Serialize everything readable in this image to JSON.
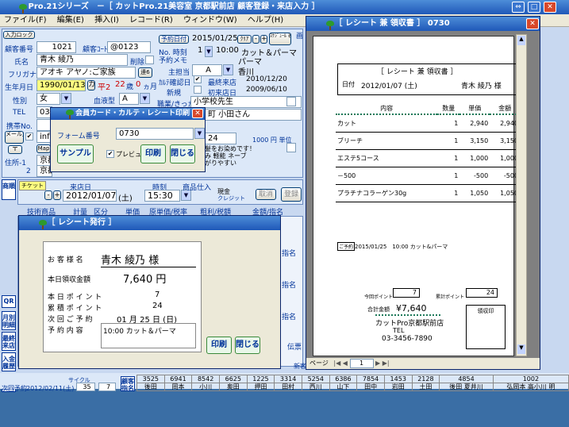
{
  "app": {
    "title": "Pro.21シリーズ　－［ カットPro.21美容室 京都駅前店 顧客登録・来店入力 ］"
  },
  "menu": [
    "ファイル(F)",
    "編集(E)",
    "挿入(I)",
    "レコード(R)",
    "ウィンドウ(W)",
    "ヘルプ(H)"
  ],
  "customer": {
    "entry_label": "入力ロック",
    "no_label": "顧客番号",
    "no": "1021",
    "code_label": "顧客ｺｰﾄﾞ",
    "code": "@0123",
    "name_label": "氏名",
    "name": "青木 綾乃",
    "delete_label": "削除",
    "kana_label": "フリガナ",
    "kana": "アオキ アヤノ:ご家族",
    "family_btn": "連6",
    "birth_label": "生年月日",
    "birth": "1990/01/13",
    "era": "平2",
    "age": "22",
    "age_unit": "歳",
    "months": "0",
    "months_unit": "ヵ月",
    "sex_label": "性別",
    "sex": "女",
    "blood_label": "血液型",
    "blood": "A",
    "tel_label": "TEL",
    "tel": "03-",
    "mobile_label": "携帯No.",
    "mail": "info",
    "addr_btn": "〒",
    "addr_label": "住所-1",
    "addr2_num": "2",
    "addr1": "京都",
    "addr2": "京都",
    "btn_mail": "メール送信",
    "btn_map": "Map"
  },
  "reserve": {
    "date_label": "予約日付",
    "date": "2015/01/25",
    "clear": "ｸﾘｱ",
    "btn_minus": "-",
    "btn_plus": "+",
    "sched_btn": "ｽｹｼﾞｭｰﾙ 表示",
    "no_label": "No. 時刻",
    "no": "1",
    "time": "10:00",
    "menu": "カット＆パーマ",
    "memo_label": "予約メモ",
    "staff_label": "主担当",
    "staff_code": "A",
    "staff_name": "香川",
    "dm_label": "ｶﾙﾃ確認日",
    "last_visit_label": "最終来店",
    "last_visit": "2010/12/20",
    "new_label": "新規",
    "first_visit_label": "初来店日",
    "first_visit": "2009/06/10",
    "job_label": "職業/きっかけ",
    "job": "小学校先生",
    "intro": "町 小田さん",
    "points": "24",
    "unit": "1000 円 単位",
    "note1": "髪をお染めです！",
    "note2": "み 軽能 ネーブ",
    "note3": "がりやすい"
  },
  "visit": {
    "tickets": "チケット",
    "date_label": "来店日",
    "date": "2012/01/07",
    "dow": "(土)",
    "time_label": "時刻",
    "time": "15:30",
    "goods_label": "商品仕入",
    "cash": "現金",
    "credit": "クレジット",
    "cancel": "取消",
    "register": "登録"
  },
  "table_head": [
    "技術商品",
    "計量",
    "区分",
    "単価",
    "原単価/税率",
    "粗利/税額",
    "金額/指名",
    "担当・年"
  ],
  "print_dialog": {
    "title": "会員カード・カルテ・レシート印刷",
    "form_label": "フォーム番号",
    "form_value": "0730",
    "sample": "サンプル",
    "preview": "プレビュー",
    "print": "印刷",
    "close": "閉じる"
  },
  "receipt_dialog": {
    "title": "［ レシート発行 ］",
    "customer_label": "お 客 様 名",
    "customer": "青木 綾乃 様",
    "received_label": "本日領収金額",
    "received": "7,640 円",
    "today_points_label": "本 日 ポ イ ン ト",
    "today_points": "7",
    "total_points_label": "累 積 ポ イ ン ト",
    "total_points": "24",
    "next_label": "次 回 ご 予 約",
    "next": "01 月 25 日 (日)",
    "content_label": "予 約 内 容",
    "content": "10:00 カット＆パーマ",
    "print": "印刷",
    "close": "閉じる"
  },
  "receipt_window": {
    "title": "［ レシート 兼 領収書 ］ 0730",
    "doc_title": "［ レシート 兼 領収書 ］",
    "date_label": "日付",
    "date": "2012/01/07 (土)",
    "customer": "青木 綾乃 様",
    "cols": [
      "内容",
      "数量",
      "単価",
      "金額"
    ],
    "rows": [
      {
        "item": "カット",
        "qty": "1",
        "price": "2,940",
        "amount": "2,940"
      },
      {
        "item": "ブリーチ",
        "qty": "1",
        "price": "3,150",
        "amount": "3,150"
      },
      {
        "item": "エステ5コース",
        "qty": "1",
        "price": "1,000",
        "amount": "1,000"
      },
      {
        "item": "－500",
        "qty": "1",
        "price": "-500",
        "amount": "-500"
      },
      {
        "item": "プラチナコラーゲン30g",
        "qty": "1",
        "price": "1,050",
        "amount": "1,050"
      }
    ],
    "next_tag": "ご予約",
    "next": "2015/01/25　10:00 カット&パーマ",
    "today_pt_label": "今回ポイント",
    "today_pt": "7",
    "total_pt_label": "累計ポイント",
    "total_pt": "24",
    "total_label": "合計金額",
    "total": "¥7,640",
    "shop": "カットPro京都駅前店",
    "tel_label": "TEL",
    "tel": "03-3456-7890",
    "stamp": "領収印",
    "page_label": "ページ",
    "page": "1"
  },
  "sidebar": [
    "商順",
    "QR",
    "月別 明細",
    "最終 来店",
    "入金 履歴",
    "明細 出力"
  ],
  "right_side": [
    "画",
    "指名",
    "指名",
    "指名",
    "伝票",
    "新客"
  ],
  "bottom": {
    "next_label": "次回予約",
    "next_date": "2012/02/11(土)",
    "next_a": "35",
    "next_b": "7",
    "cycle": "サイクル",
    "pick": "顧客 指名",
    "nums": [
      "3525",
      "6941",
      "8542",
      "6625",
      "1225",
      "3314",
      "5254",
      "6386",
      "7854",
      "1453",
      "2128",
      "4854",
      "1002"
    ],
    "names": [
      "後田",
      "岡本",
      "小川",
      "奥田",
      "押田",
      "田村",
      "西川",
      "山下",
      "田中",
      "岩田",
      "土田",
      "後田 夏井川",
      "弘岡本 高小川 明"
    ]
  }
}
